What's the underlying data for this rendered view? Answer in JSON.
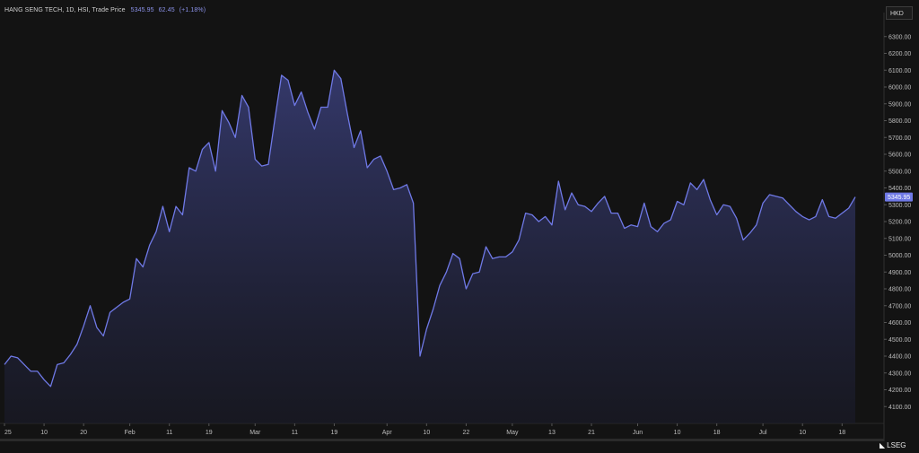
{
  "header": {
    "title": "HANG SENG TECH, 1D, HSI, Trade Price",
    "last_price": "5345.95",
    "change": "62.45",
    "change_pct": "(+1.18%)"
  },
  "currency_button": "HKD",
  "brand": "LSEG",
  "colors": {
    "background": "#131313",
    "line": "#6f79e6",
    "area_top": "#3a3f7a",
    "area_bottom": "#1a1b2a",
    "price_tag": "#6f79e6"
  },
  "chart_data": {
    "type": "area",
    "title": "HANG SENG TECH",
    "currency": "HKD",
    "ylim": [
      4000,
      6400
    ],
    "y_ticks": [
      "6300.00",
      "6200.00",
      "6100.00",
      "6000.00",
      "5900.00",
      "5800.00",
      "5700.00",
      "5600.00",
      "5500.00",
      "5400.00",
      "5300.00",
      "5200.00",
      "5100.00",
      "5000.00",
      "4900.00",
      "4800.00",
      "4700.00",
      "4600.00",
      "4500.00",
      "4400.00",
      "4300.00",
      "4200.00",
      "4100.00"
    ],
    "y_tick_values": [
      6300,
      6200,
      6100,
      6000,
      5900,
      5800,
      5700,
      5600,
      5500,
      5400,
      5300,
      5200,
      5100,
      5000,
      4900,
      4800,
      4700,
      4600,
      4500,
      4400,
      4300,
      4200,
      4100
    ],
    "x_tick_labels": [
      "25",
      "10",
      "20",
      "Feb",
      "11",
      "19",
      "Mar",
      "11",
      "19",
      "Apr",
      "10",
      "22",
      "May",
      "13",
      "21",
      "Jun",
      "10",
      "18",
      "Jul",
      "10",
      "18"
    ],
    "x_tick_index": [
      0,
      6,
      12,
      19,
      25,
      31,
      38,
      44,
      50,
      58,
      64,
      70,
      77,
      83,
      89,
      96,
      102,
      108,
      115,
      121,
      127
    ],
    "last_value": "5345.95",
    "values": [
      4350,
      4400,
      4390,
      4350,
      4310,
      4310,
      4260,
      4220,
      4350,
      4360,
      4410,
      4470,
      4580,
      4700,
      4570,
      4520,
      4660,
      4690,
      4720,
      4740,
      4980,
      4930,
      5060,
      5140,
      5290,
      5140,
      5290,
      5240,
      5520,
      5500,
      5630,
      5670,
      5500,
      5860,
      5790,
      5700,
      5950,
      5880,
      5570,
      5530,
      5540,
      5810,
      6070,
      6040,
      5890,
      5970,
      5850,
      5750,
      5880,
      5880,
      6100,
      6050,
      5840,
      5640,
      5740,
      5520,
      5570,
      5590,
      5500,
      5390,
      5400,
      5420,
      5310,
      4400,
      4560,
      4680,
      4820,
      4900,
      5010,
      4980,
      4800,
      4890,
      4900,
      5050,
      4980,
      4990,
      4990,
      5020,
      5090,
      5250,
      5240,
      5200,
      5230,
      5180,
      5440,
      5270,
      5370,
      5300,
      5290,
      5260,
      5310,
      5350,
      5250,
      5250,
      5160,
      5180,
      5170,
      5310,
      5170,
      5140,
      5190,
      5210,
      5320,
      5300,
      5430,
      5390,
      5450,
      5330,
      5240,
      5300,
      5290,
      5220,
      5090,
      5130,
      5180,
      5310,
      5360,
      5350,
      5340,
      5300,
      5260,
      5230,
      5210,
      5230,
      5330,
      5230,
      5220,
      5250,
      5280,
      5346
    ]
  }
}
